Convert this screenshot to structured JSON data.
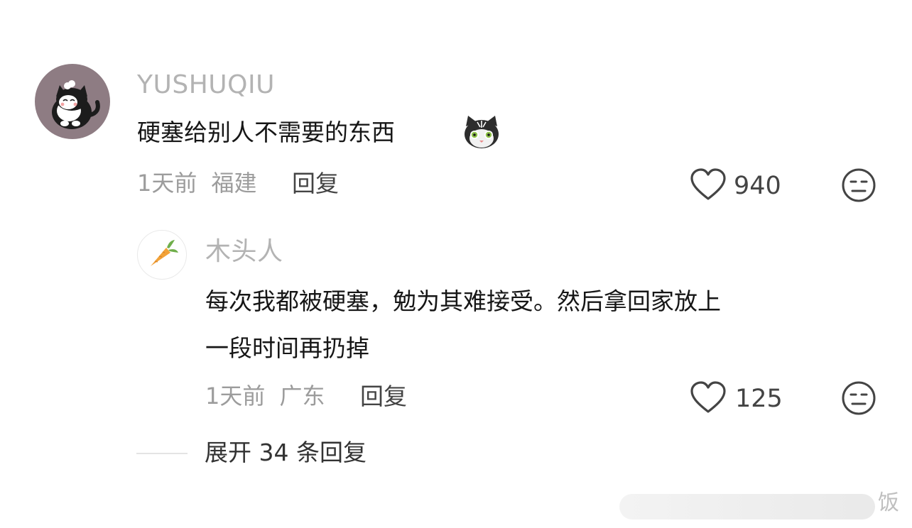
{
  "comments": [
    {
      "username": "YUSHUQIU",
      "avatar_icon": "cat-avatar-icon",
      "text_lines": [
        "硬塞给别人不需要的东西"
      ],
      "emoji_icon": "cat-face-emoji-icon",
      "time": "1天前",
      "location": "福建",
      "reply_label": "回复",
      "like_icon": "heart-outline-icon",
      "likes": "940",
      "dislike_icon": "meh-face-icon"
    },
    {
      "username": "木头人",
      "avatar_icon": "carrot-avatar-icon",
      "text_lines": [
        "每次我都被硬塞，勉为其难接受。然后拿回家放上",
        "一段时间再扔掉"
      ],
      "time": "1天前",
      "location": "广东",
      "reply_label": "回复",
      "like_icon": "heart-outline-icon",
      "likes": "125",
      "dislike_icon": "meh-face-icon"
    }
  ],
  "expand": {
    "label": "展开 34 条回复"
  },
  "watermark": {
    "text": "饭"
  },
  "colors": {
    "username": "#b3b3b3",
    "text": "#161616",
    "meta": "#9c9c9c",
    "action": "#444444"
  }
}
